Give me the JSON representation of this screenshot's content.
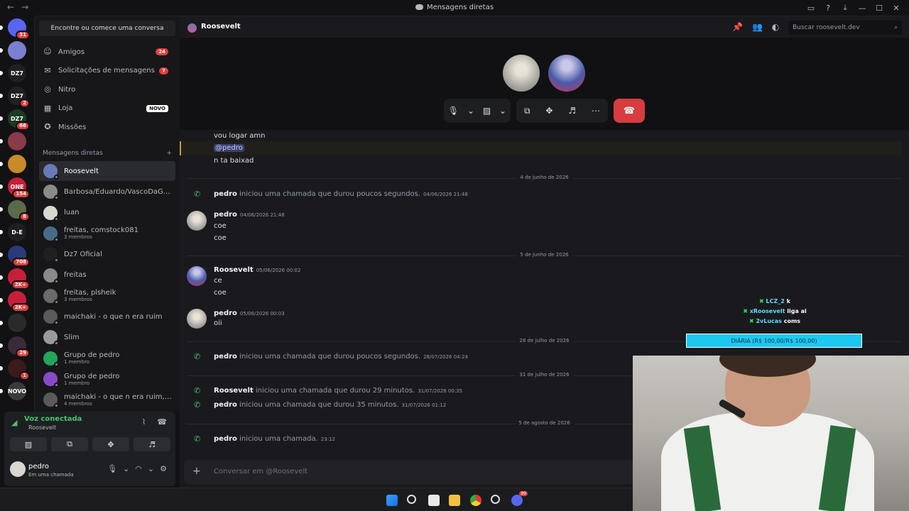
{
  "window": {
    "title": "Mensagens diretas"
  },
  "servers": [
    {
      "label": "",
      "badge": "31",
      "color": "#5865f2"
    },
    {
      "label": "",
      "badge": "",
      "color": "#7a7fd0"
    },
    {
      "label": "DZ7",
      "badge": "",
      "color": "#202022"
    },
    {
      "label": "DZ7",
      "badge": "2",
      "color": "#202022"
    },
    {
      "label": "DZ7",
      "badge": "66",
      "color": "#1d3a24"
    },
    {
      "label": "",
      "badge": "",
      "color": "#8a3a4a"
    },
    {
      "label": "",
      "badge": "",
      "color": "#c88a2a"
    },
    {
      "label": "ONE",
      "badge": "154",
      "color": "#c81e3a"
    },
    {
      "label": "",
      "badge": "8",
      "color": "#5a6a4a"
    },
    {
      "label": "D-E",
      "badge": "",
      "color": "#1e1f22"
    },
    {
      "label": "",
      "badge": "708",
      "color": "#2a3a7a"
    },
    {
      "label": "",
      "badge": "2K+",
      "color": "#c81e3a"
    },
    {
      "label": "",
      "badge": "2K+",
      "color": "#c81e3a"
    },
    {
      "label": "",
      "badge": "",
      "color": "#2a2a2a"
    },
    {
      "label": "",
      "badge": "29",
      "color": "#3a2a3a"
    },
    {
      "label": "",
      "badge": "1",
      "color": "#3a1a1a"
    },
    {
      "label": "NOVO",
      "badge": "",
      "color": "#3a3a3a"
    }
  ],
  "sidebar": {
    "search_label": "Encontre ou comece uma conversa",
    "nav": [
      {
        "label": "Amigos",
        "count": "24",
        "icon": "friends-icon",
        "glyph": "☺"
      },
      {
        "label": "Solicitações de mensagens",
        "count": "7",
        "icon": "mail-icon",
        "glyph": "✉"
      },
      {
        "label": "Nitro",
        "count": "",
        "icon": "nitro-icon",
        "glyph": "◎"
      },
      {
        "label": "Loja",
        "count": "",
        "new": "NOVO",
        "icon": "shop-icon",
        "glyph": "▦"
      },
      {
        "label": "Missões",
        "count": "",
        "icon": "quests-icon",
        "glyph": "✪"
      }
    ],
    "section_title": "Mensagens diretas",
    "section_add": "+",
    "dms": [
      {
        "name": "Roosevelt",
        "sub": "",
        "active": true,
        "color": "#6a7ab8"
      },
      {
        "name": "Barbosa/Eduardo/VascoDaGam...",
        "sub": "",
        "color": "#8a8a8a"
      },
      {
        "name": "luan",
        "sub": "",
        "color": "#d8d8d0"
      },
      {
        "name": "freitas, comstock081",
        "sub": "3 membros",
        "color": "#4a6a8a"
      },
      {
        "name": "Dz7 Oficial",
        "sub": "",
        "color": "#202022"
      },
      {
        "name": "freitas",
        "sub": "",
        "color": "#8a8a8a"
      },
      {
        "name": "freitas, plsheik",
        "sub": "3 membros",
        "color": "#6a6a6a"
      },
      {
        "name": "maichaki - o que n era ruim",
        "sub": "",
        "color": "#5a5a5a"
      },
      {
        "name": "Slim",
        "sub": "",
        "color": "#9a9a9a"
      },
      {
        "name": "Grupo de pedro",
        "sub": "1 membro",
        "color": "#23a55a"
      },
      {
        "name": "Grupo de pedro",
        "sub": "1 membro",
        "color": "#8a4ac8"
      },
      {
        "name": "maichaki - o que n era ruim, Roo...",
        "sub": "4 membros",
        "color": "#5a5a5a"
      }
    ]
  },
  "voice": {
    "status": "Voz conectada",
    "channel": "Roosevelt"
  },
  "user": {
    "name": "pedro",
    "status": "Em uma chamada"
  },
  "header": {
    "name": "Roosevelt",
    "search_placeholder": "Buscar roosevelt.dev"
  },
  "messages": {
    "top_lines": [
      "vou logar amn",
      "@pedro",
      "n ta baixad"
    ],
    "dividers": [
      "4 de junho de 2026",
      "5 de junho de 2026",
      "28 de julho de 2026",
      "31 de julho de 2026",
      "5 de agosto de 2026"
    ],
    "sys1": {
      "author": "pedro",
      "text": "iniciou uma chamada que durou poucos segundos.",
      "time": "04/06/2026 21:48"
    },
    "m1": {
      "author": "pedro",
      "time": "04/06/2026 21:48",
      "lines": [
        "coe",
        "coe"
      ]
    },
    "m2": {
      "author": "Roosevelt",
      "time": "05/06/2026 00:02",
      "lines": [
        "ce",
        "coe"
      ]
    },
    "m3": {
      "author": "pedro",
      "time": "05/06/2026 00:03",
      "lines": [
        "oii"
      ]
    },
    "sys2": {
      "author": "pedro",
      "text": "iniciou uma chamada que durou poucos segundos.",
      "time": "28/07/2026 04:24"
    },
    "sys3": {
      "author": "Roosevelt",
      "text": "iniciou uma chamada que durou 29 minutos.",
      "time": "31/07/2026 00:35"
    },
    "sys4": {
      "author": "pedro",
      "text": "iniciou uma chamada que durou 35 minutos.",
      "time": "31/07/2026 01:12"
    },
    "sys5": {
      "author": "pedro",
      "text": "iniciou uma chamada.",
      "time": "23:12"
    }
  },
  "composer": {
    "placeholder": "Conversar em @Roosevelt"
  },
  "overlay": {
    "chat": [
      {
        "name": "LCZ_2",
        "text": "k"
      },
      {
        "name": "xRoosevelt",
        "text": "liga ai"
      },
      {
        "name": "2vLucas",
        "text": "coms"
      }
    ],
    "goal": "DIÁRIA (R$ 100,00/R$ 100,00)"
  },
  "taskbar": {
    "discord_badge": "99"
  }
}
